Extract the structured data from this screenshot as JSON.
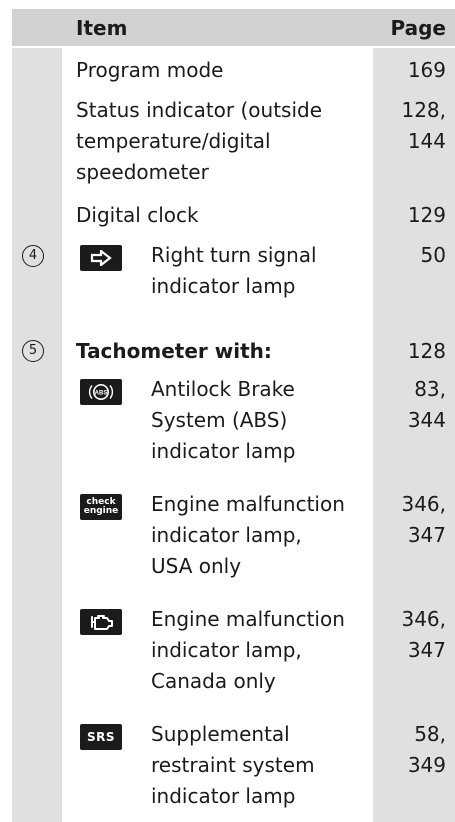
{
  "header": {
    "item": "Item",
    "page": "Page"
  },
  "rows": [
    {
      "lines": [
        "Program mode"
      ],
      "page": "169"
    },
    {
      "lines": [
        "Status indicator (outside",
        "temperature/digital",
        "speedometer"
      ],
      "page_lines": [
        "128,",
        "144"
      ]
    },
    {
      "lines": [
        "Digital clock"
      ],
      "page": "129"
    },
    {
      "number": "4",
      "icon": "right-arrow",
      "lines": [
        "Right turn signal",
        "indicator lamp"
      ],
      "page": "50"
    },
    {
      "number": "5",
      "lines": [
        "Tachometer with:"
      ],
      "page": "128"
    },
    {
      "icon": "abs",
      "icon_text": "ABS",
      "lines": [
        "Antilock Brake",
        "System (ABS)",
        "indicator lamp"
      ],
      "page_lines": [
        "83,",
        "344"
      ]
    },
    {
      "icon": "check-engine",
      "icon_text": [
        "check",
        "engine"
      ],
      "lines": [
        "Engine malfunction",
        "indicator lamp,",
        "USA only"
      ],
      "page_lines": [
        "346,",
        "347"
      ]
    },
    {
      "icon": "engine",
      "lines": [
        "Engine malfunction",
        "indicator lamp,",
        "Canada only"
      ],
      "page_lines": [
        "346,",
        "347"
      ]
    },
    {
      "icon": "srs",
      "icon_text": "SRS",
      "lines": [
        "Supplemental",
        "restraint system",
        "indicator lamp"
      ],
      "page_lines": [
        "58,",
        "349"
      ]
    }
  ]
}
